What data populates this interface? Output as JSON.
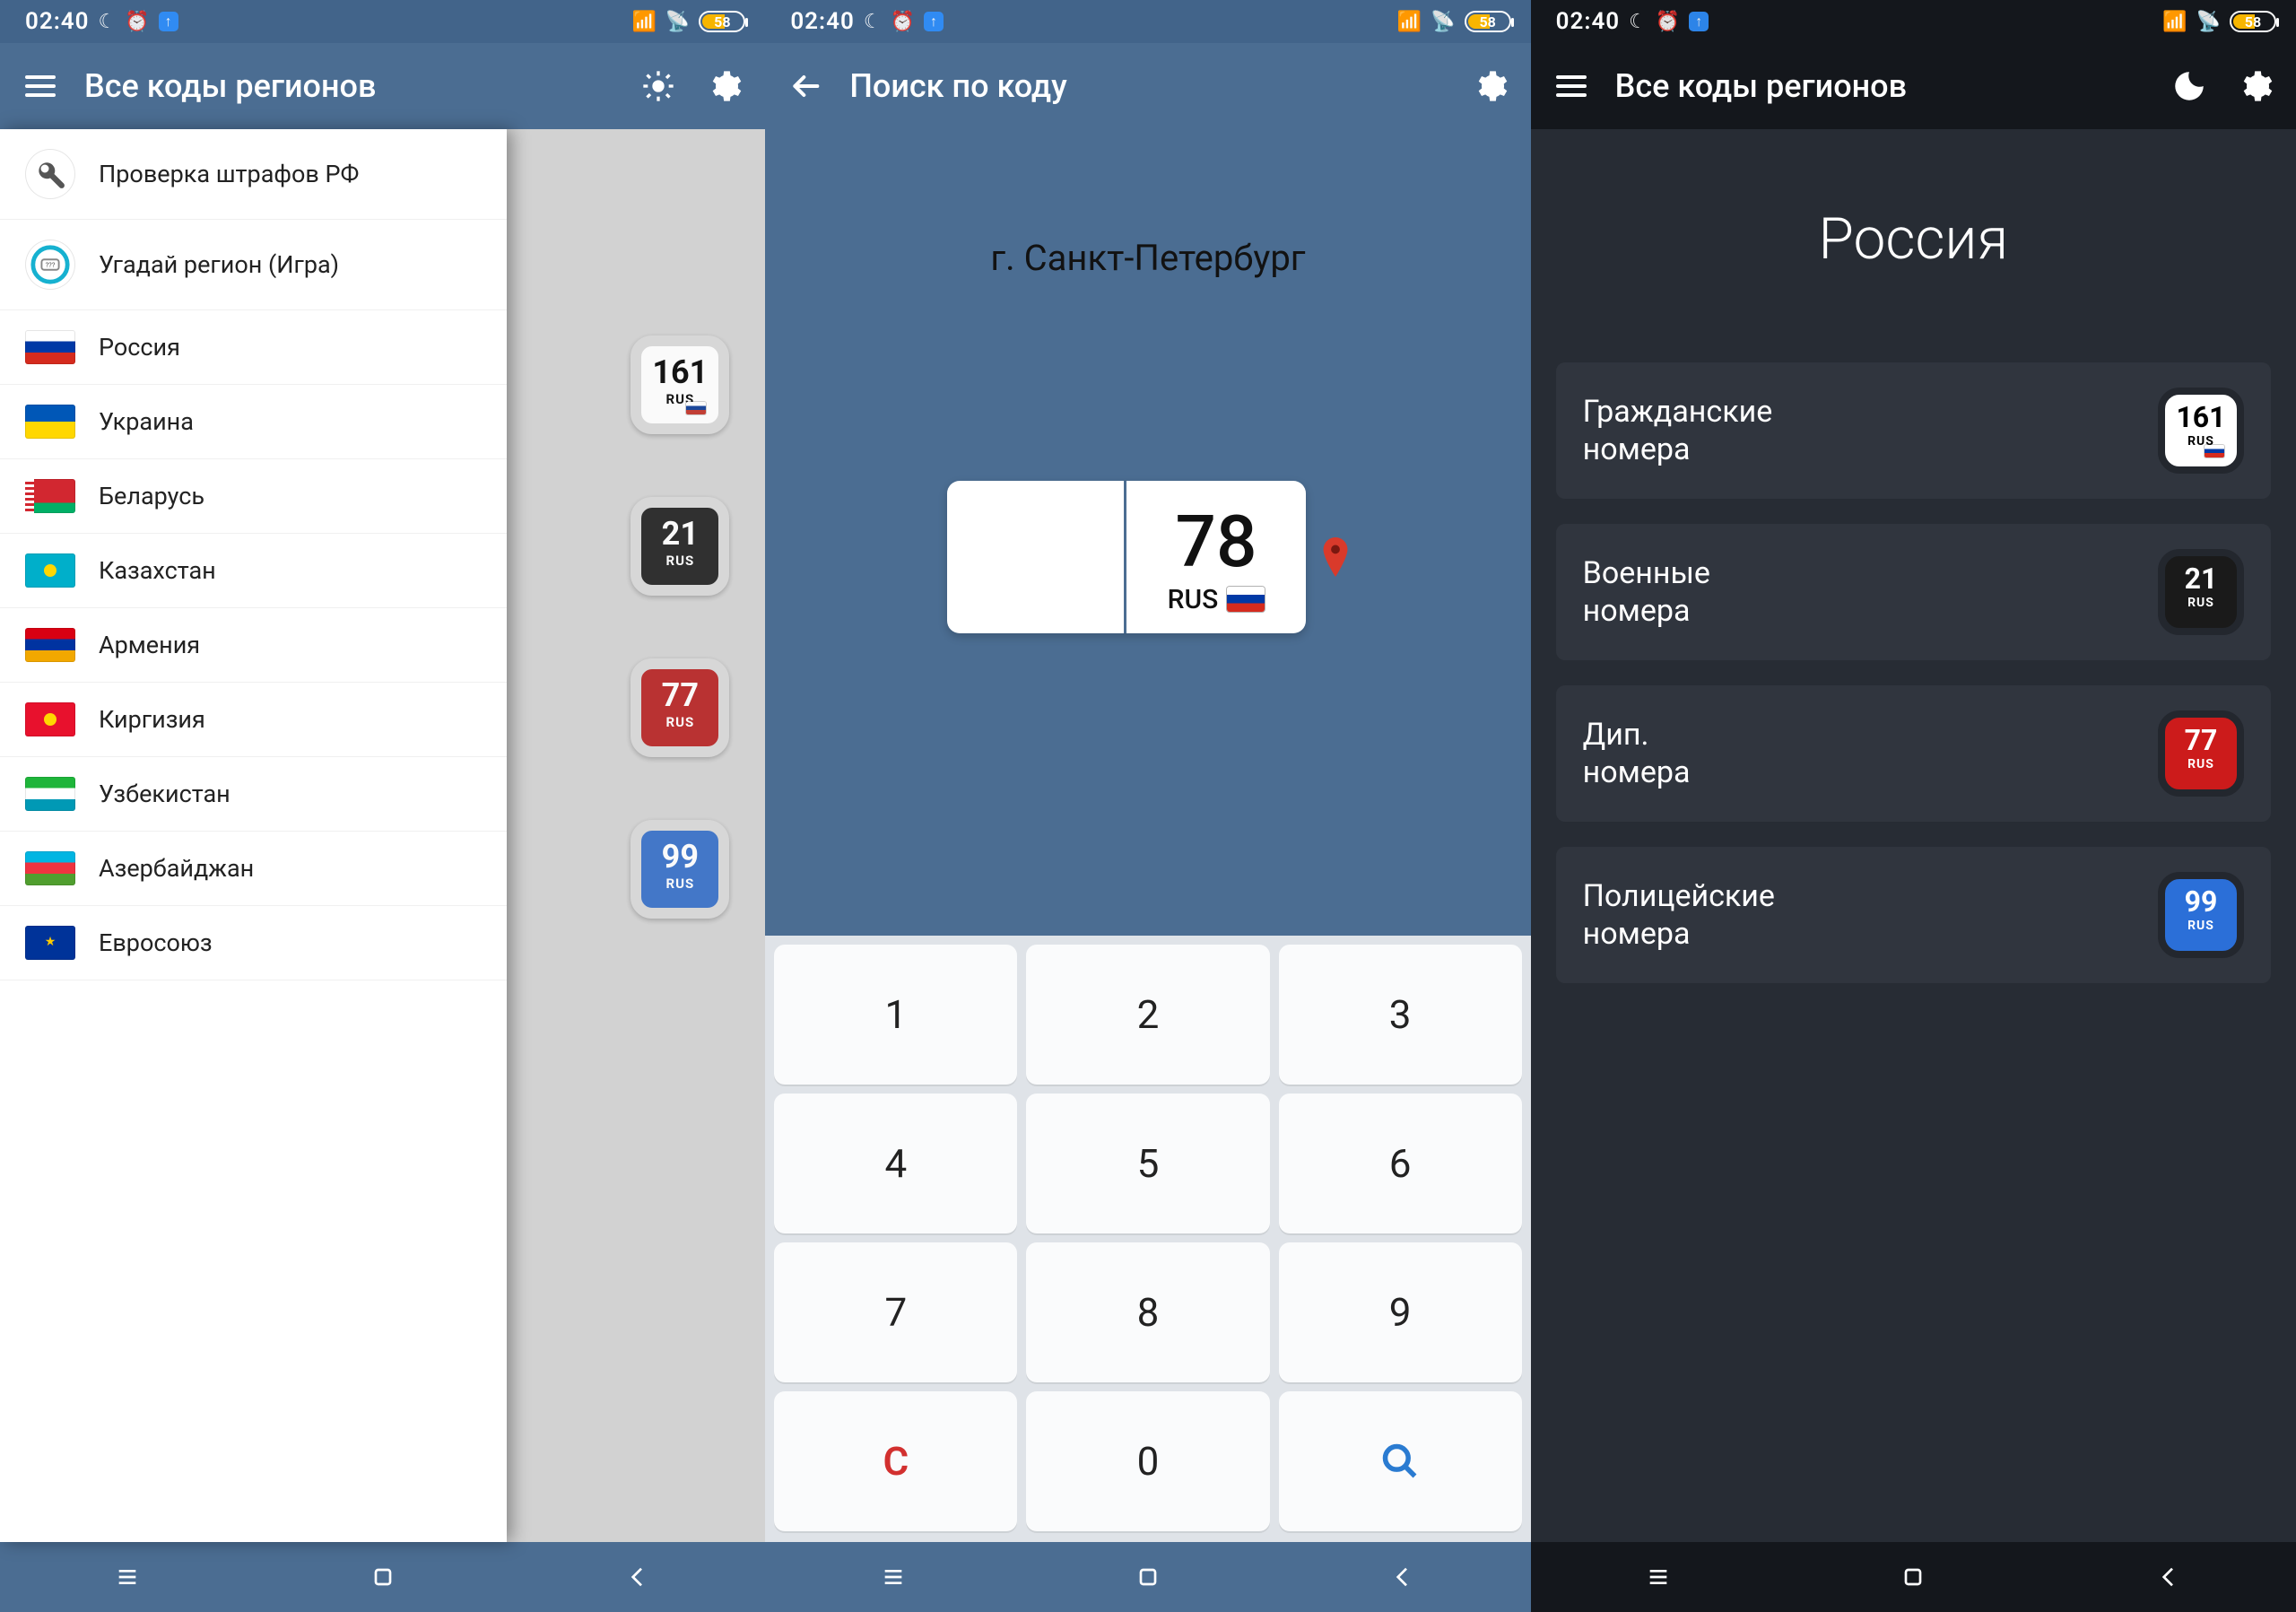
{
  "status": {
    "time": "02:40",
    "battery_text": "58"
  },
  "s1": {
    "appbar_title": "Все коды регионов",
    "drawer": [
      {
        "label": "Проверка штрафов РФ",
        "kind": "wrench"
      },
      {
        "label": "Угадай регион (Игра)",
        "kind": "game"
      },
      {
        "label": "Россия",
        "kind": "flag-ru"
      },
      {
        "label": "Украина",
        "kind": "flag-ua"
      },
      {
        "label": "Беларусь",
        "kind": "flag-by"
      },
      {
        "label": "Казахстан",
        "kind": "flag-kz"
      },
      {
        "label": "Армения",
        "kind": "flag-am"
      },
      {
        "label": "Киргизия",
        "kind": "flag-kg"
      },
      {
        "label": "Узбекистан",
        "kind": "flag-uz"
      },
      {
        "label": "Азербайджан",
        "kind": "flag-az"
      },
      {
        "label": "Евросоюз",
        "kind": "flag-eu"
      }
    ],
    "back_badges": [
      {
        "num": "161",
        "rus": "RUS",
        "style": "white",
        "flag": true
      },
      {
        "num": "21",
        "rus": "RUS",
        "style": "dark",
        "flag": false
      },
      {
        "num": "77",
        "rus": "RUS",
        "style": "red",
        "flag": false
      },
      {
        "num": "99",
        "rus": "RUS",
        "style": "blue",
        "flag": false
      }
    ]
  },
  "s2": {
    "appbar_title": "Поиск по коду",
    "result_name": "г. Санкт-Петербург",
    "plate_code": "78",
    "plate_rus": "RUS",
    "keys": [
      "1",
      "2",
      "3",
      "4",
      "5",
      "6",
      "7",
      "8",
      "9",
      "C",
      "0",
      "search"
    ]
  },
  "s3": {
    "appbar_title": "Все коды регионов",
    "big_title": "Россия",
    "cards": [
      {
        "line1": "Гражданские",
        "line2": "номера",
        "num": "161",
        "rus": "RUS",
        "style": "white",
        "flag": true
      },
      {
        "line1": "Военные",
        "line2": "номера",
        "num": "21",
        "rus": "RUS",
        "style": "dark",
        "flag": false
      },
      {
        "line1": "Дип.",
        "line2": "номера",
        "num": "77",
        "rus": "RUS",
        "style": "red",
        "flag": false
      },
      {
        "line1": "Полицейские",
        "line2": "номера",
        "num": "99",
        "rus": "RUS",
        "style": "blue",
        "flag": false
      }
    ]
  }
}
